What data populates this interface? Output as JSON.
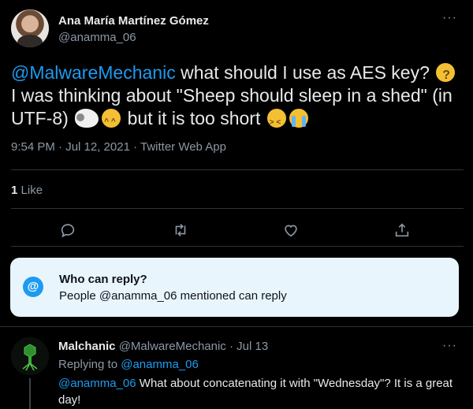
{
  "tweet": {
    "author_name": "Ana María Martínez Gómez",
    "author_handle": "@anamma_06",
    "more_icon": "more-horizontal-icon",
    "text": {
      "mention": "@MalwareMechanic",
      "part1": " what should I use as AES key?",
      "part2": "I was thinking about \"Sheep should sleep in a shed\" (in UTF-8)",
      "part3": " but it is too short"
    },
    "emojis": [
      "thinking-face-emoji",
      "sheep-emoji",
      "grinning-squinting-face-emoji",
      "tired-face-emoji",
      "loudly-crying-face-emoji"
    ],
    "timestamp": "9:54 PM · Jul 12, 2021 · Twitter Web App",
    "likes_count": "1",
    "likes_label": "Like",
    "actions": [
      "reply-icon",
      "retweet-icon",
      "like-icon",
      "share-icon"
    ]
  },
  "who_can_reply": {
    "icon": "@",
    "title": "Who can reply?",
    "description": "People @anamma_06 mentioned can reply"
  },
  "reply": {
    "author_name": "Malchanic",
    "meta": "@MalwareMechanic · Jul 13",
    "replying_prefix": "Replying to",
    "replying_handle": "@anamma_06",
    "body_mention": "@anamma_06",
    "body_text": " What about concatenating it with \"Wednesday\"? It is a great day!"
  },
  "colors": {
    "background": "#000000",
    "text": "#e7e9ea",
    "muted": "#8b98a5",
    "accent": "#1d9bf0",
    "reply_box": "#e8f5fd"
  }
}
